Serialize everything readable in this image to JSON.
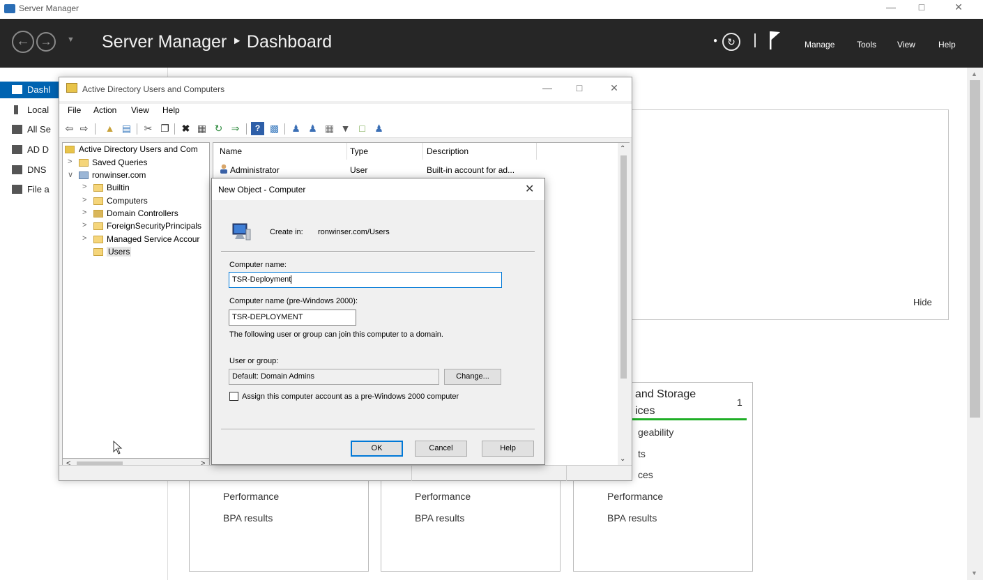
{
  "server_manager": {
    "window_title": "Server Manager",
    "breadcrumb": "Server Manager ‣ Dashboard",
    "header_menus": [
      "Manage",
      "Tools",
      "View",
      "Help"
    ],
    "nav_items": [
      {
        "label": "Dashl",
        "icon": "dashboard-icon"
      },
      {
        "label": "Local",
        "icon": "local-server-icon"
      },
      {
        "label": "All Se",
        "icon": "all-servers-icon"
      },
      {
        "label": "AD D",
        "icon": "ad-ds-icon"
      },
      {
        "label": "DNS",
        "icon": "dns-icon"
      },
      {
        "label": "File a",
        "icon": "file-storage-icon"
      }
    ],
    "hide_link": "Hide",
    "tiles": [
      {
        "title": "",
        "lines": [
          "Performance",
          "BPA results"
        ]
      },
      {
        "title": "",
        "lines": [
          "Performance",
          "BPA results"
        ]
      },
      {
        "title_line1": "and Storage",
        "title_line2": "ices",
        "count": "1",
        "partial_lines": [
          "geability",
          "ts",
          "ces"
        ],
        "lines": [
          "Performance",
          "BPA results"
        ]
      }
    ]
  },
  "aduc": {
    "title": "Active Directory Users and Computers",
    "menus": [
      "File",
      "Action",
      "View",
      "Help"
    ],
    "tree": {
      "root": "Active Directory Users and Com",
      "items": [
        {
          "label": "Saved Queries",
          "expand": ">"
        },
        {
          "label": "ronwinser.com",
          "expand": "∨"
        },
        {
          "label": "Builtin",
          "expand": ">"
        },
        {
          "label": "Computers",
          "expand": ">"
        },
        {
          "label": "Domain Controllers",
          "expand": ">"
        },
        {
          "label": "ForeignSecurityPrincipals",
          "expand": ">"
        },
        {
          "label": "Managed Service Accour",
          "expand": ">"
        },
        {
          "label": "Users",
          "expand": ""
        }
      ]
    },
    "list": {
      "columns": [
        "Name",
        "Type",
        "Description"
      ],
      "rows": [
        {
          "name": "Administrator",
          "type": "User",
          "description": "Built-in account for ad..."
        }
      ]
    }
  },
  "dialog": {
    "title": "New Object - Computer",
    "create_in_label": "Create in:",
    "create_in_path": "ronwinser.com/Users",
    "computer_name_label": "Computer name:",
    "computer_name_value": "TSR-Deployment",
    "pre2000_label": "Computer name (pre-Windows 2000):",
    "pre2000_value": "TSR-DEPLOYMENT",
    "join_text": "The following user or group can join this computer to a domain.",
    "user_group_label": "User or group:",
    "user_group_value": "Default: Domain Admins",
    "change_button": "Change...",
    "checkbox_label": "Assign this computer account as a pre-Windows 2000 computer",
    "checkbox_checked": false,
    "ok_button": "OK",
    "cancel_button": "Cancel",
    "help_button": "Help"
  }
}
